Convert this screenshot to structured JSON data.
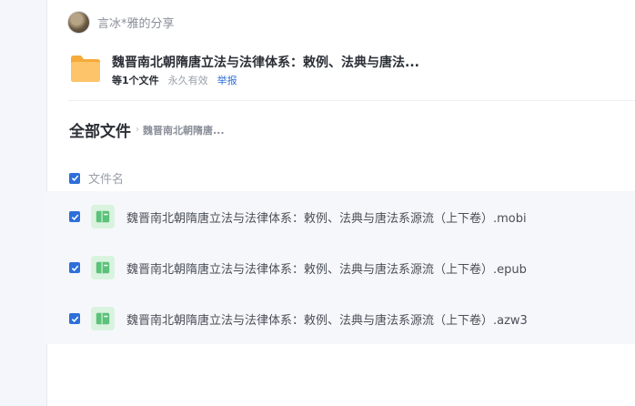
{
  "share": {
    "sharer": "言冰*雅的分享",
    "title": "魏晋南北朝隋唐立法与法律体系：敕例、法典与唐法...",
    "count": "等1个文件",
    "validity": "永久有效",
    "report": "举报"
  },
  "breadcrumb": {
    "root": "全部文件",
    "separator": "›",
    "current": "魏晋南北朝隋唐..."
  },
  "list": {
    "header": "文件名",
    "files": [
      {
        "name": "魏晋南北朝隋唐立法与法律体系：敕例、法典与唐法系源流（上下卷）.mobi",
        "checked": true
      },
      {
        "name": "魏晋南北朝隋唐立法与法律体系：敕例、法典与唐法系源流（上下卷）.epub",
        "checked": true
      },
      {
        "name": "魏晋南北朝隋唐立法与法律体系：敕例、法典与唐法系源流（上下卷）.azw3",
        "checked": true
      }
    ]
  },
  "colors": {
    "accent": "#2e6fd8",
    "folder": "#fdb953",
    "file_icon": "#5cc17a",
    "row_background": "#f6f7fb"
  },
  "icons": {
    "folder": "folder-icon",
    "file": "ebook-file-icon",
    "checkbox": "checkbox-checked-icon"
  }
}
